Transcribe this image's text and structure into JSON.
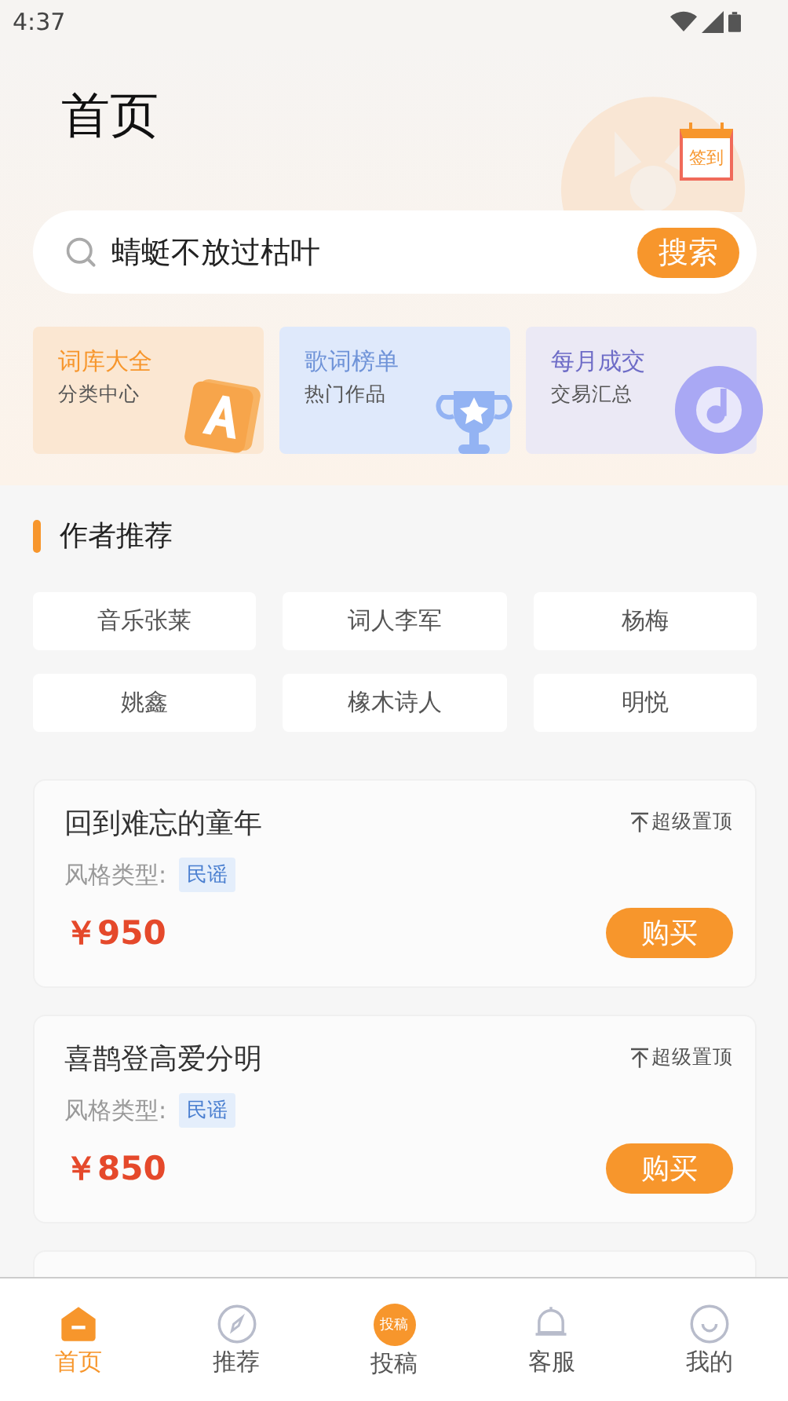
{
  "status_bar": {
    "time": "4:37"
  },
  "header": {
    "title": "首页",
    "checkin_label": "签到"
  },
  "search": {
    "value": "蜻蜓不放过枯叶",
    "button": "搜索"
  },
  "categories": [
    {
      "kind": "book",
      "title": "词库大全",
      "subtitle": "分类中心"
    },
    {
      "kind": "trophy",
      "title": "歌词榜单",
      "subtitle": "热门作品"
    },
    {
      "kind": "music",
      "title": "每月成交",
      "subtitle": "交易汇总"
    }
  ],
  "authors_section": {
    "title": "作者推荐",
    "authors": [
      "音乐张莱",
      "词人李军",
      "杨梅",
      "姚鑫",
      "橡木诗人",
      "明悦"
    ]
  },
  "works": [
    {
      "title": "回到难忘的童年",
      "pin": "超级置顶",
      "style_label": "风格类型:",
      "tag": "民谣",
      "price": "￥950",
      "button": "购买"
    },
    {
      "title": "喜鹊登高爱分明",
      "pin": "超级置顶",
      "style_label": "风格类型:",
      "tag": "民谣",
      "price": "￥850",
      "button": "购买"
    }
  ],
  "tab_bar": [
    {
      "kind": "home",
      "label": "首页",
      "selected": true
    },
    {
      "kind": "compass",
      "label": "推荐",
      "selected": false
    },
    {
      "kind": "submit",
      "label": "投稿",
      "icon_text": "投稿",
      "selected": false
    },
    {
      "kind": "bell",
      "label": "客服",
      "selected": false
    },
    {
      "kind": "smile",
      "label": "我的",
      "selected": false
    }
  ]
}
